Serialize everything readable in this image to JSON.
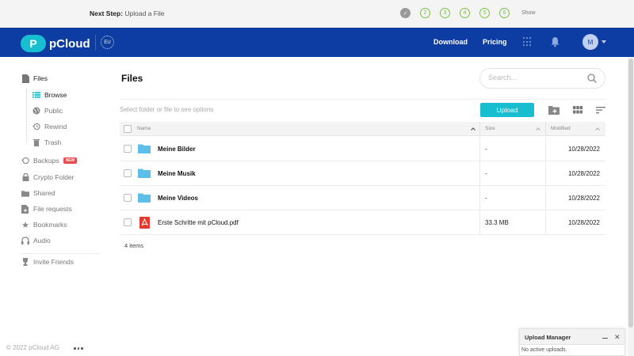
{
  "stepbar": {
    "label_bold": "Next Step:",
    "label_text": "Upload a File",
    "steps": [
      "2",
      "3",
      "4",
      "5",
      "6"
    ],
    "show_label": "Show"
  },
  "header": {
    "brand": "pCloud",
    "logo_letter": "P",
    "region": "EU",
    "download_label": "Download",
    "pricing_label": "Pricing",
    "avatar_letter": "M",
    "bg_color": "#0d3da3",
    "accent_color": "#17bed0"
  },
  "sidebar": {
    "files": "Files",
    "browse": "Browse",
    "public": "Public",
    "rewind": "Rewind",
    "trash": "Trash",
    "backups": "Backups",
    "backups_badge": "NEW",
    "crypto": "Crypto Folder",
    "shared": "Shared",
    "file_requests": "File requests",
    "bookmarks": "Bookmarks",
    "audio": "Audio",
    "invite": "Invite Friends"
  },
  "main": {
    "title": "Files",
    "search_placeholder": "Search...",
    "hint": "Select folder or file to see options",
    "upload_label": "Upload",
    "columns": {
      "name": "Name",
      "size": "Size",
      "modified": "Modified"
    },
    "rows": [
      {
        "name": "Meine Bilder",
        "type": "folder",
        "size": "-",
        "modified": "10/28/2022"
      },
      {
        "name": "Meine Musik",
        "type": "folder",
        "size": "-",
        "modified": "10/28/2022"
      },
      {
        "name": "Meine Videos",
        "type": "folder",
        "size": "-",
        "modified": "10/28/2022"
      },
      {
        "name": "Erste Schritte mit pCloud.pdf",
        "type": "pdf",
        "size": "33.3 MB",
        "modified": "10/28/2022"
      }
    ],
    "count": "4 items"
  },
  "footer": {
    "copyright": "© 2022 pCloud AG"
  },
  "upload_manager": {
    "title": "Upload Manager",
    "status": "No active uploads."
  }
}
